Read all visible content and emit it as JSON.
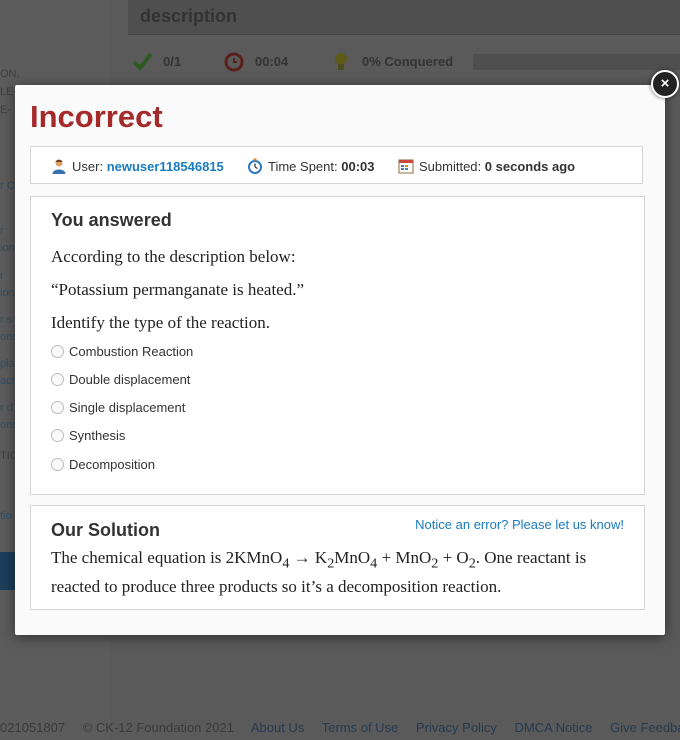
{
  "background": {
    "description_header": "description",
    "stats": [
      {
        "icon": "checkmark-icon",
        "value": "0/1"
      },
      {
        "icon": "alarm-clock-icon",
        "value": "00:04"
      },
      {
        "icon": "lightbulb-icon",
        "value": "0% Conquered"
      }
    ],
    "sidebar_fragments": [
      "ON,",
      "LE-",
      "E-",
      "r C",
      "r",
      "ion",
      "r",
      "ion",
      "r s",
      "ons",
      "pla",
      "act",
      "r d",
      "ons",
      "TIC",
      "tio",
      "tion"
    ],
    "footer": {
      "build": "021051807",
      "copyright": "© CK-12 Foundation 2021",
      "links": [
        "About Us",
        "Terms of Use",
        "Privacy Policy",
        "DMCA Notice",
        "Give Feedback"
      ]
    }
  },
  "modal": {
    "title": "Incorrect",
    "close_symbol": "×",
    "info": {
      "user_label": "User:",
      "user_value": "newuser118546815",
      "time_label": "Time Spent:",
      "time_value": "00:03",
      "submitted_label": "Submitted:",
      "submitted_value": "0 seconds ago"
    },
    "answer": {
      "heading": "You answered",
      "question_lines": [
        "According to the description below:",
        "“Potassium permanganate is heated.”",
        "Identify the type of the reaction."
      ],
      "options": [
        "Combustion Reaction",
        "Double displacement",
        "Single displacement",
        "Synthesis",
        "Decomposition"
      ]
    },
    "solution": {
      "heading": "Our Solution",
      "notice_link": "Notice an error? Please let us know!",
      "equation_prefix": "The chemical equation is 2KMnO",
      "sub_4": "4",
      "sub_2": "2",
      "arrow": " → K",
      "mno": "MnO",
      "plus_mno": " + MnO",
      "plus_o": " + O",
      "equation_suffix": ". One reactant is reacted to produce three products so it’s a decomposition reaction."
    }
  }
}
